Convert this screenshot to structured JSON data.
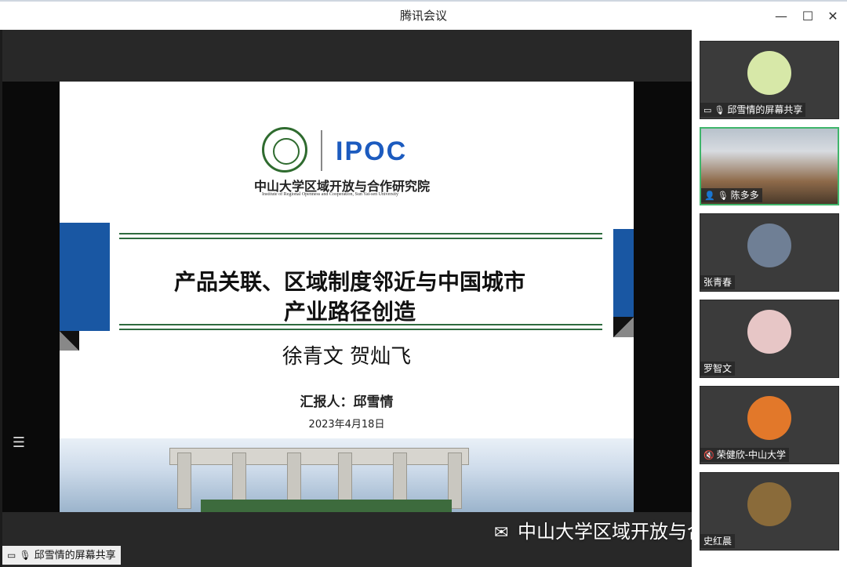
{
  "window": {
    "title": "腾讯会议",
    "minimize_label": "—",
    "maximize_label": "☐",
    "close_label": "✕"
  },
  "slide": {
    "institute_cn": "中山大学区域开放与合作研究院",
    "institute_en": "Institute of Regional Openness and Cooperation, Sun Yat-sen University",
    "logo_text": "IPOC",
    "title_line1": "产品关联、区域制度邻近与中国城市",
    "title_line2": "产业路径创造",
    "authors": "徐青文  贺灿飞",
    "reporter": "汇报人：邱雪情",
    "date": "2023年4月18日"
  },
  "stage": {
    "menu_icon": "☰",
    "share_label": "邱雪情的屏幕共享"
  },
  "watermark": "中山大学区域开放与合作研究院",
  "participants": [
    {
      "name": "邱雪情的屏幕共享",
      "icons": [
        "screen-share-icon",
        "mic-icon"
      ],
      "avatar_color": "#d7e8a8",
      "active": false
    },
    {
      "name": "陈多多",
      "icons": [
        "user-icon",
        "mic-icon"
      ],
      "avatar_color": "",
      "active": true
    },
    {
      "name": "张青春",
      "icons": [],
      "avatar_color": "#6f7f95",
      "active": false
    },
    {
      "name": "罗智文",
      "icons": [],
      "avatar_color": "#e7c6c6",
      "active": false
    },
    {
      "name": "荣健欣-中山大学",
      "icons": [
        "mic-muted-icon"
      ],
      "avatar_color": "#e2782a",
      "active": false
    },
    {
      "name": "史红晨",
      "icons": [],
      "avatar_color": "#8a6b3a",
      "active": false
    }
  ],
  "colors": {
    "accent_green": "#3fb56b",
    "slide_blue": "#1957a3",
    "line_green": "#2e6b3e"
  }
}
